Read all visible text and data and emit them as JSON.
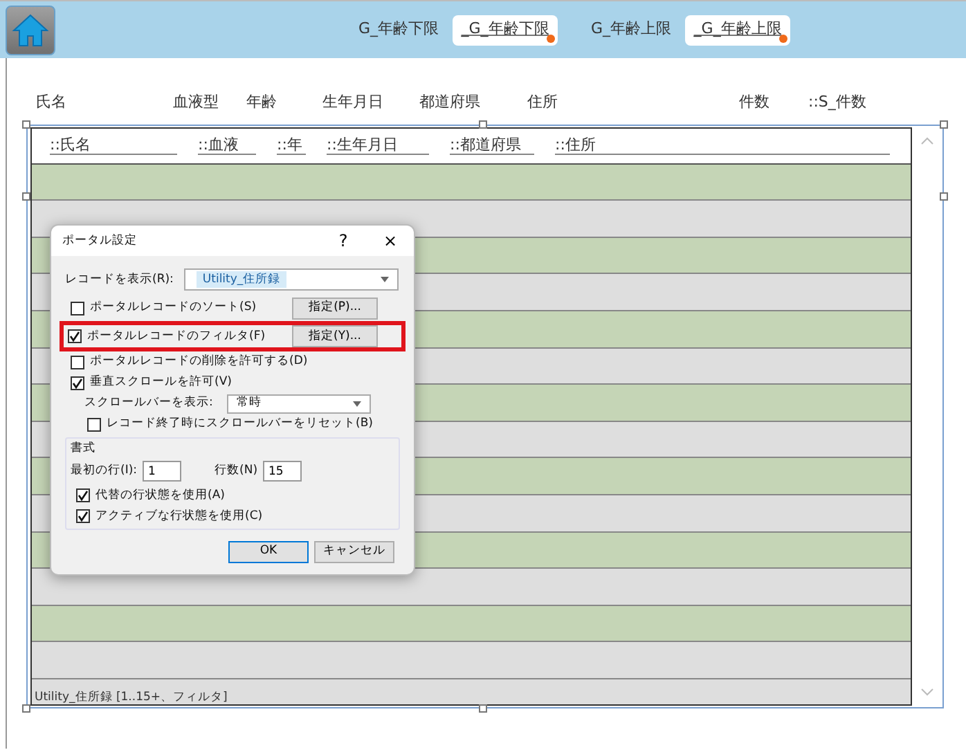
{
  "header": {
    "filters": [
      {
        "label": "G_年齢下限",
        "field": "_G_年齢下限"
      },
      {
        "label": "G_年齢上限",
        "field": "_G_年齢上限"
      }
    ]
  },
  "column_headers": [
    "氏名",
    "血液型",
    "年齢",
    "生年月日",
    "都道府県",
    "住所",
    "件数",
    "::S_件数"
  ],
  "portal": {
    "fields": [
      "::氏名",
      "::血液",
      "::年",
      "::生年月日",
      "::都道府県",
      "::住所"
    ],
    "rows": [
      {
        "alternate": true
      },
      {
        "alternate": false
      },
      {
        "alternate": true
      },
      {
        "alternate": false
      },
      {
        "alternate": true
      },
      {
        "alternate": false
      },
      {
        "alternate": true
      },
      {
        "alternate": false
      },
      {
        "alternate": true
      },
      {
        "alternate": false
      },
      {
        "alternate": true
      },
      {
        "alternate": false
      },
      {
        "alternate": true
      },
      {
        "alternate": false
      }
    ],
    "footer_label": "Utility_住所録 [1..15+、フィルタ]"
  },
  "dialog": {
    "title": "ポータル設定",
    "help": "?",
    "close": "×",
    "record_source": {
      "label": "レコードを表示(R):",
      "value": "Utility_住所録"
    },
    "options": [
      {
        "kind": "checkbox",
        "label": "ポータルレコードのソート(S)",
        "checked": false,
        "button": "指定(P)...",
        "highlighted": false
      },
      {
        "kind": "checkbox",
        "label": "ポータルレコードのフィルタ(F)",
        "checked": true,
        "button": "指定(Y)...",
        "highlighted": true
      },
      {
        "kind": "checkbox",
        "label": "ポータルレコードの削除を許可する(D)",
        "checked": false,
        "highlighted": false
      },
      {
        "kind": "checkbox",
        "label": "垂直スクロールを許可(V)",
        "checked": true,
        "highlighted": false
      },
      {
        "kind": "select",
        "label": "スクロールバーを表示:",
        "value": "常時"
      },
      {
        "kind": "subcheckbox",
        "label": "レコード終了時にスクロールバーをリセット(B)",
        "checked": false
      }
    ],
    "format": {
      "title": "書式",
      "first_row": {
        "label": "最初の行(I):",
        "value": "1"
      },
      "row_count": {
        "label": "行数(N)",
        "value": "15"
      },
      "options": [
        {
          "label": "代替の行状態を使用(A)",
          "checked": true
        },
        {
          "label": "アクティブな行状態を使用(C)",
          "checked": true
        }
      ]
    },
    "buttons": [
      "OK",
      "キャンセル"
    ]
  }
}
